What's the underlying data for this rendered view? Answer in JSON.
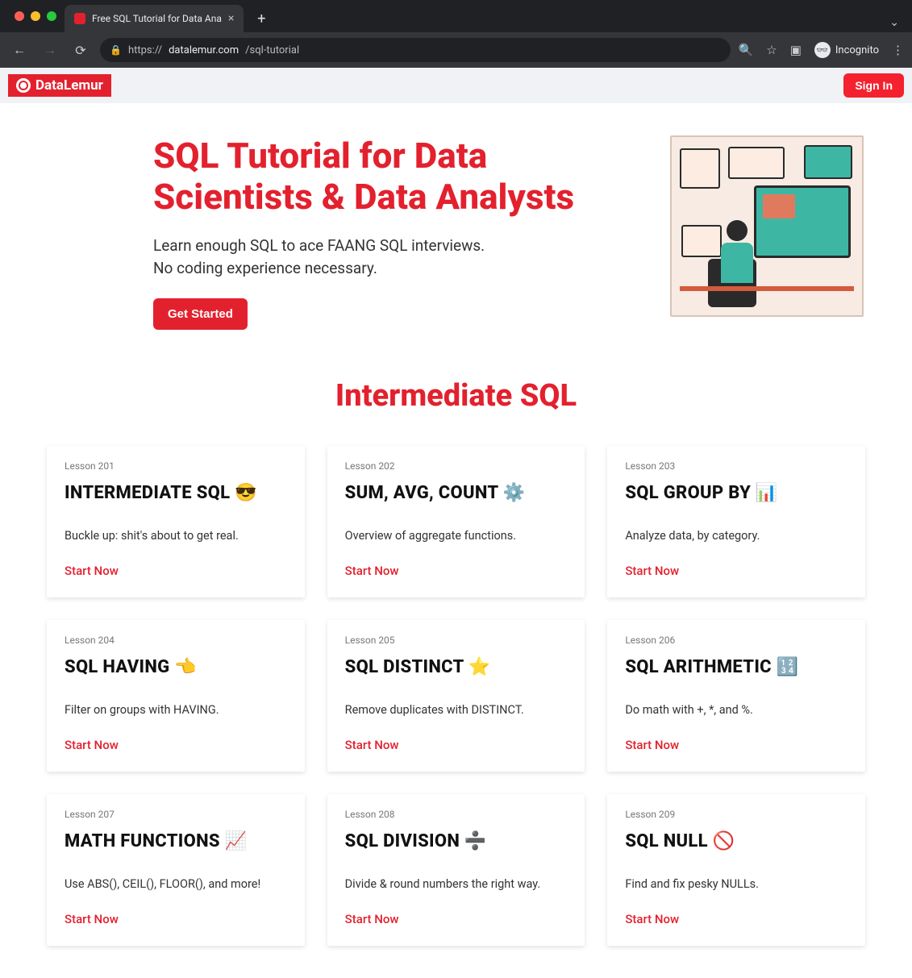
{
  "browser": {
    "tab_title": "Free SQL Tutorial for Data Ana",
    "new_tab_tooltip": "+",
    "url_display": {
      "prefix": "https://",
      "domain": "datalemur.com",
      "path": "/sql-tutorial"
    },
    "incognito_label": "Incognito"
  },
  "header": {
    "brand": "DataLemur",
    "signin": "Sign In"
  },
  "hero": {
    "title": "SQL Tutorial for Data Scientists & Data Analysts",
    "subtitle": "Learn enough SQL to ace FAANG SQL interviews. No coding experience necessary.",
    "cta": "Get Started"
  },
  "section_title": "Intermediate SQL",
  "cards": [
    {
      "eyebrow": "Lesson 201",
      "title": "INTERMEDIATE SQL 😎",
      "desc": "Buckle up: shit's about to get real.",
      "cta": "Start Now"
    },
    {
      "eyebrow": "Lesson 202",
      "title": "SUM, AVG, COUNT ⚙️",
      "desc": "Overview of aggregate functions.",
      "cta": "Start Now"
    },
    {
      "eyebrow": "Lesson 203",
      "title": "SQL GROUP BY 📊",
      "desc": "Analyze data, by category.",
      "cta": "Start Now"
    },
    {
      "eyebrow": "Lesson 204",
      "title": "SQL HAVING 👈",
      "desc": "Filter on groups with HAVING.",
      "cta": "Start Now"
    },
    {
      "eyebrow": "Lesson 205",
      "title": "SQL DISTINCT ⭐",
      "desc": "Remove duplicates with DISTINCT.",
      "cta": "Start Now"
    },
    {
      "eyebrow": "Lesson 206",
      "title": "SQL ARITHMETIC 🔢",
      "desc": "Do math with +, *, and %.",
      "cta": "Start Now"
    },
    {
      "eyebrow": "Lesson 207",
      "title": "MATH FUNCTIONS 📈",
      "desc": "Use ABS(), CEIL(), FLOOR(), and more!",
      "cta": "Start Now"
    },
    {
      "eyebrow": "Lesson 208",
      "title": "SQL DIVISION ➗",
      "desc": "Divide & round numbers the right way.",
      "cta": "Start Now"
    },
    {
      "eyebrow": "Lesson 209",
      "title": "SQL NULL 🚫",
      "desc": "Find and fix pesky NULLs.",
      "cta": "Start Now"
    }
  ]
}
